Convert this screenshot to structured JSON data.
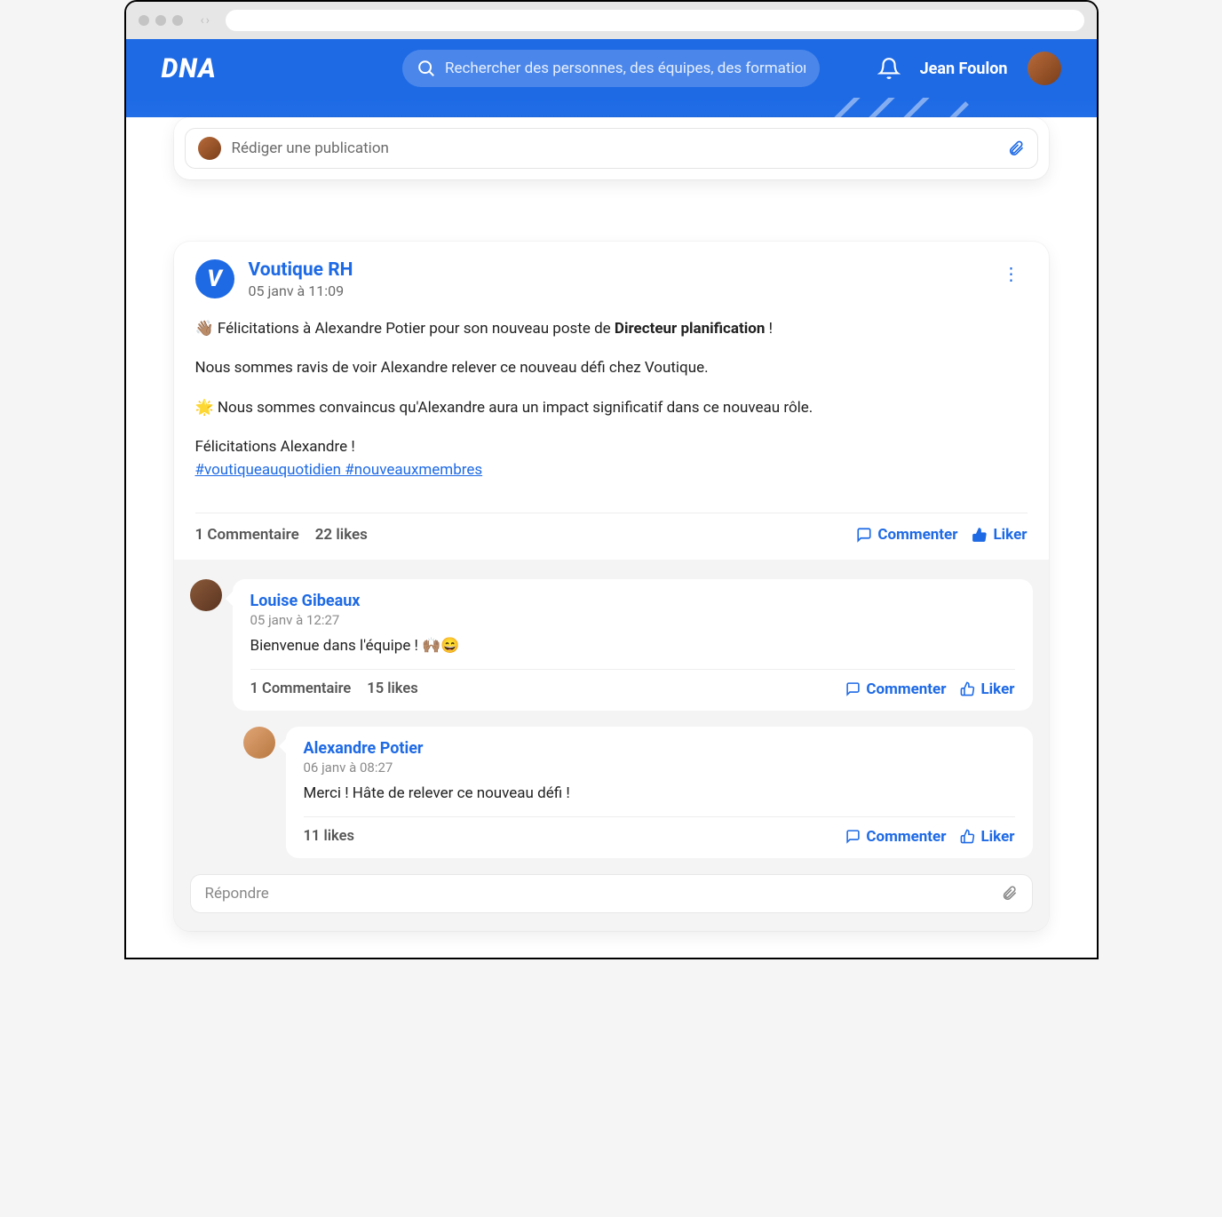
{
  "app": {
    "logo": "DNA"
  },
  "search": {
    "placeholder": "Rechercher des personnes, des équipes, des formation..."
  },
  "user": {
    "name": "Jean Foulon"
  },
  "composer": {
    "placeholder": "Rédiger une publication"
  },
  "post": {
    "author": "Voutique RH",
    "author_initial": "V",
    "time": "05 janv à 11:09",
    "line1_prefix": "👋🏽 Félicitations à Alexandre Potier pour son nouveau poste de ",
    "line1_bold": "Directeur planification",
    "line1_suffix": " !",
    "line2": "Nous sommes ravis de voir Alexandre relever ce nouveau défi chez Voutique.",
    "line3": "🌟 Nous sommes convaincus qu'Alexandre aura un impact significatif dans ce nouveau rôle.",
    "line4": "Félicitations Alexandre !",
    "hashtags": "#voutiqueauquotidien #nouveauxmembres",
    "comments_count": "1 Commentaire",
    "likes_count": "22 likes",
    "comment_btn": "Commenter",
    "like_btn": "Liker"
  },
  "comments": [
    {
      "author": "Louise Gibeaux",
      "time": "05 janv à 12:27",
      "text": "Bienvenue dans l'équipe ! 🙌🏽😄",
      "comments_count": "1 Commentaire",
      "likes_count": "15 likes",
      "comment_btn": "Commenter",
      "like_btn": "Liker"
    },
    {
      "author": "Alexandre Potier",
      "time": "06 janv à 08:27",
      "text": "Merci ! Hâte de relever ce nouveau défi !",
      "likes_count": "11 likes",
      "comment_btn": "Commenter",
      "like_btn": "Liker"
    }
  ],
  "reply": {
    "placeholder": "Répondre"
  }
}
